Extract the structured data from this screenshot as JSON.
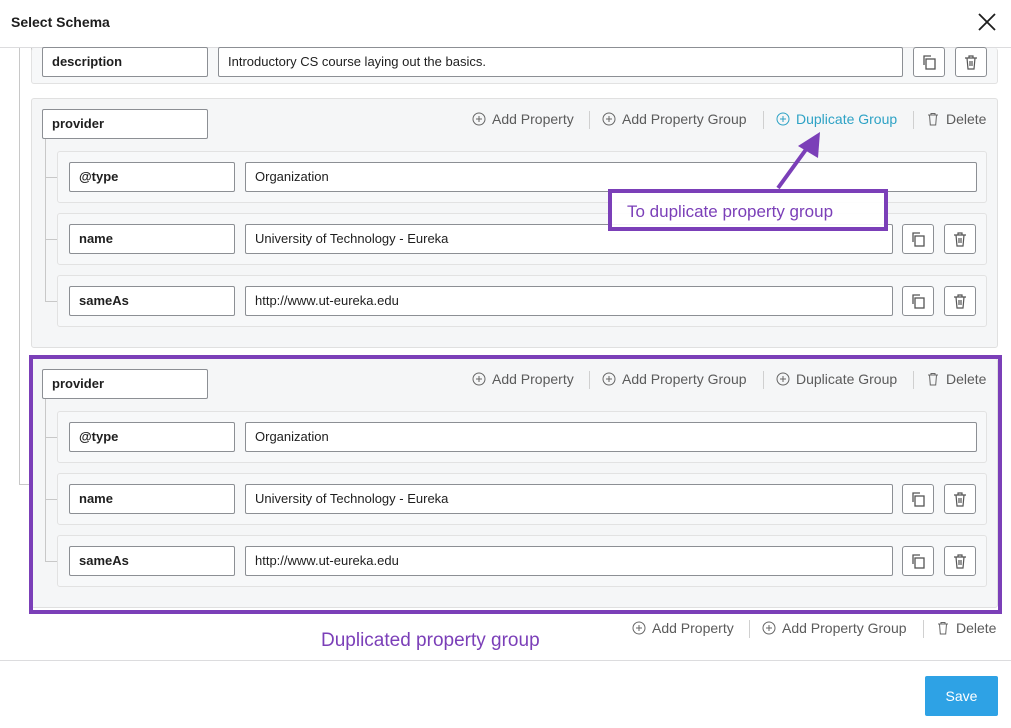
{
  "dialog": {
    "title": "Select Schema",
    "save_label": "Save"
  },
  "top_row": {
    "key": "description",
    "value": "Introductory CS course laying out the basics."
  },
  "groups": [
    {
      "key": "provider",
      "actions": {
        "add_property": "Add Property",
        "add_property_group": "Add Property Group",
        "duplicate_group": "Duplicate Group",
        "delete": "Delete"
      },
      "rows": [
        {
          "key": "@type",
          "value": "Organization"
        },
        {
          "key": "name",
          "value": "University of Technology - Eureka"
        },
        {
          "key": "sameAs",
          "value": "http://www.ut-eureka.edu"
        }
      ]
    },
    {
      "key": "provider",
      "actions": {
        "add_property": "Add Property",
        "add_property_group": "Add Property Group",
        "duplicate_group": "Duplicate Group",
        "delete": "Delete"
      },
      "rows": [
        {
          "key": "@type",
          "value": "Organization"
        },
        {
          "key": "name",
          "value": "University of Technology - Eureka"
        },
        {
          "key": "sameAs",
          "value": "http://www.ut-eureka.edu"
        }
      ]
    }
  ],
  "bottom_actions": {
    "add_property": "Add Property",
    "add_property_group": "Add Property Group",
    "delete": "Delete"
  },
  "annotations": {
    "duplicate_note": "To duplicate property group",
    "duplicated_caption": "Duplicated property group"
  },
  "colors": {
    "accent": "#2ea2e5",
    "annotation": "#7b3fb8",
    "link_active": "#2ea2c5"
  },
  "icons": {
    "close": "close-icon",
    "copy": "copy-icon",
    "delete": "trash-icon",
    "add": "plus-circle-icon"
  }
}
